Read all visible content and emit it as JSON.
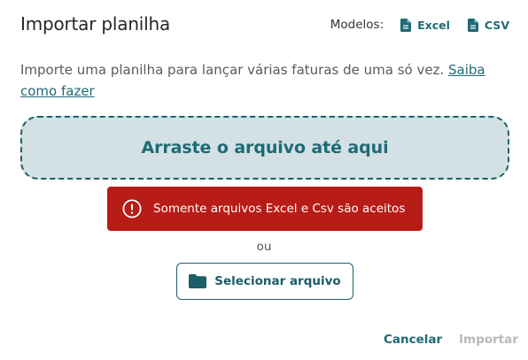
{
  "dialog": {
    "title": "Importar planilha"
  },
  "templates": {
    "label": "Modelos:",
    "items": [
      {
        "label": "Excel",
        "icon": "file-icon"
      },
      {
        "label": "CSV",
        "icon": "file-icon"
      }
    ]
  },
  "intro": {
    "text": "Importe uma planilha para lançar várias faturas de uma só vez. ",
    "link": "Saiba como fazer"
  },
  "dropzone": {
    "text": "Arraste o arquivo até aqui"
  },
  "error": {
    "icon": "alert-circle-icon",
    "message": "Somente arquivos Excel e Csv são aceitos",
    "color": "#b81c16"
  },
  "separator": {
    "text": "ou"
  },
  "select_button": {
    "icon": "folder-icon",
    "label": "Selecionar arquivo"
  },
  "actions": {
    "cancel": "Cancelar",
    "import": "Importar",
    "import_disabled": true
  },
  "colors": {
    "accent": "#1f6a77",
    "dropzone_bg": "#d3e1e4",
    "disabled": "#b9b9b9"
  }
}
